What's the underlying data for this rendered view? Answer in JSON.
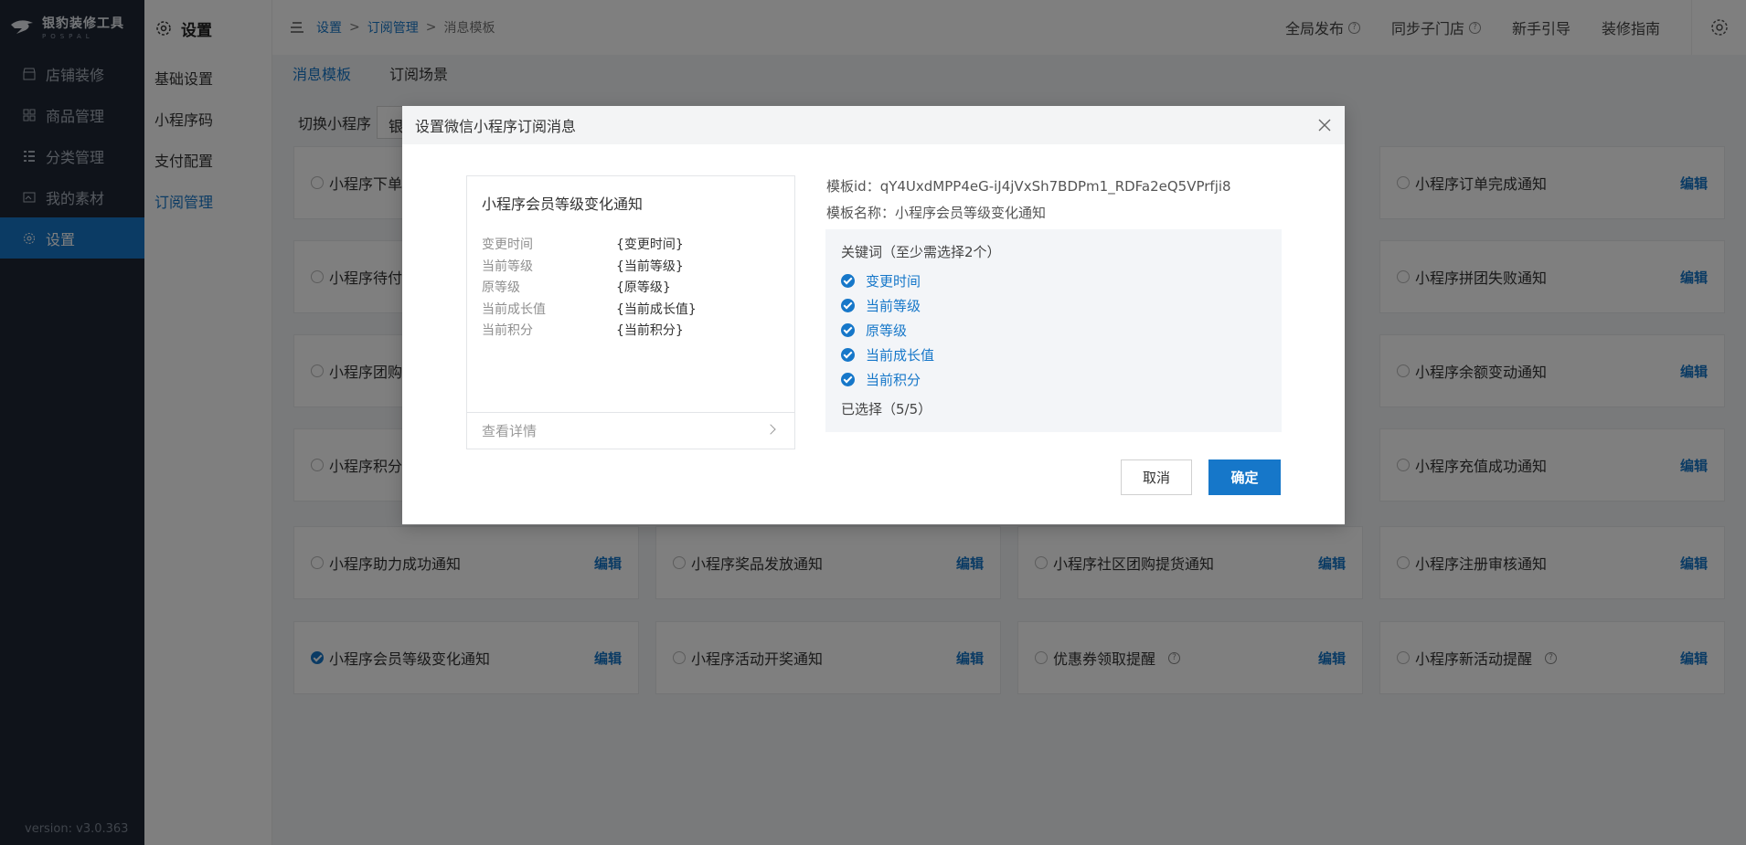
{
  "nav": {
    "brand": "银豹装修工具",
    "brand_sub": "POSPAL",
    "items": [
      {
        "label": "店铺装修",
        "icon": "store-icon"
      },
      {
        "label": "商品管理",
        "icon": "grid-icon"
      },
      {
        "label": "分类管理",
        "icon": "list-icon"
      },
      {
        "label": "我的素材",
        "icon": "image-icon"
      },
      {
        "label": "设置",
        "icon": "gear-icon",
        "active": true
      }
    ],
    "version": "version: v3.0.363"
  },
  "subnav": {
    "title": "设置",
    "links": [
      "基础设置",
      "小程序码",
      "支付配置",
      "订阅管理"
    ]
  },
  "breadcrumb": [
    "设置",
    "订阅管理",
    "消息模板"
  ],
  "topbar": [
    "全局发布",
    "同步子门店",
    "新手引导",
    "装修指南"
  ],
  "tabs": [
    "消息模板",
    "订阅场景"
  ],
  "switch_label": "切换小程序",
  "switch_value": "银",
  "edit_label": "编辑",
  "cards": [
    [
      "小程序下单",
      "",
      "",
      "小程序订单完成通知"
    ],
    [
      "小程序待付",
      "",
      "",
      "小程序拼团失败通知"
    ],
    [
      "小程序团购",
      "",
      "",
      "小程序余额变动通知"
    ],
    [
      "小程序积分",
      "",
      "",
      "小程序充值成功通知"
    ],
    [
      "小程序助力成功通知",
      "小程序奖品发放通知",
      "小程序社区团购提货通知",
      "小程序注册审核通知"
    ],
    [
      "小程序会员等级变化通知",
      "小程序活动开奖通知",
      "优惠券领取提醒",
      "小程序新活动提醒"
    ]
  ],
  "modal": {
    "title": "设置微信小程序订阅消息",
    "preview_title": "小程序会员等级变化通知",
    "preview_rows": [
      {
        "k": "变更时间",
        "v": "{变更时间}"
      },
      {
        "k": "当前等级",
        "v": "{当前等级}"
      },
      {
        "k": "原等级",
        "v": "{原等级}"
      },
      {
        "k": "当前成长值",
        "v": "{当前成长值}"
      },
      {
        "k": "当前积分",
        "v": "{当前积分}"
      }
    ],
    "detail_label": "查看详情",
    "template_id": "模板id：qY4UxdMPP4eG-iJ4jVxSh7BDPm1_RDFa2eQ5VPrfji8",
    "template_name": "模板名称：小程序会员等级变化通知",
    "keywords_title": "关键词（至少需选择2个）",
    "keywords": [
      "变更时间",
      "当前等级",
      "原等级",
      "当前成长值",
      "当前积分"
    ],
    "selected_count": "已选择（5/5）",
    "cancel": "取消",
    "ok": "确定"
  },
  "colors": {
    "accent": "#1677c9",
    "nav_bg": "#1f2735"
  }
}
